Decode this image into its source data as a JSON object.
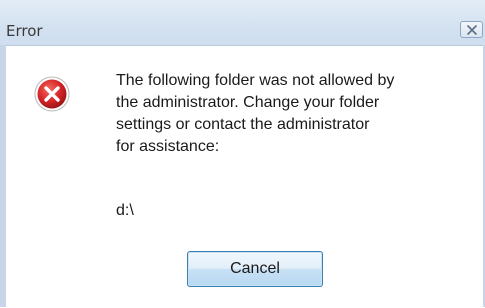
{
  "dialog": {
    "title": "Error",
    "message": "The following folder was not allowed by\nthe administrator. Change your folder\nsettings or contact the administrator\nfor assistance:",
    "path": "d:\\",
    "cancel_label": "Cancel"
  },
  "icons": {
    "error": "error-icon",
    "close": "close-icon"
  },
  "colors": {
    "error_red": "#d8262a",
    "title_bar": "#d3e1f0",
    "button_border": "#3c7fb1"
  }
}
